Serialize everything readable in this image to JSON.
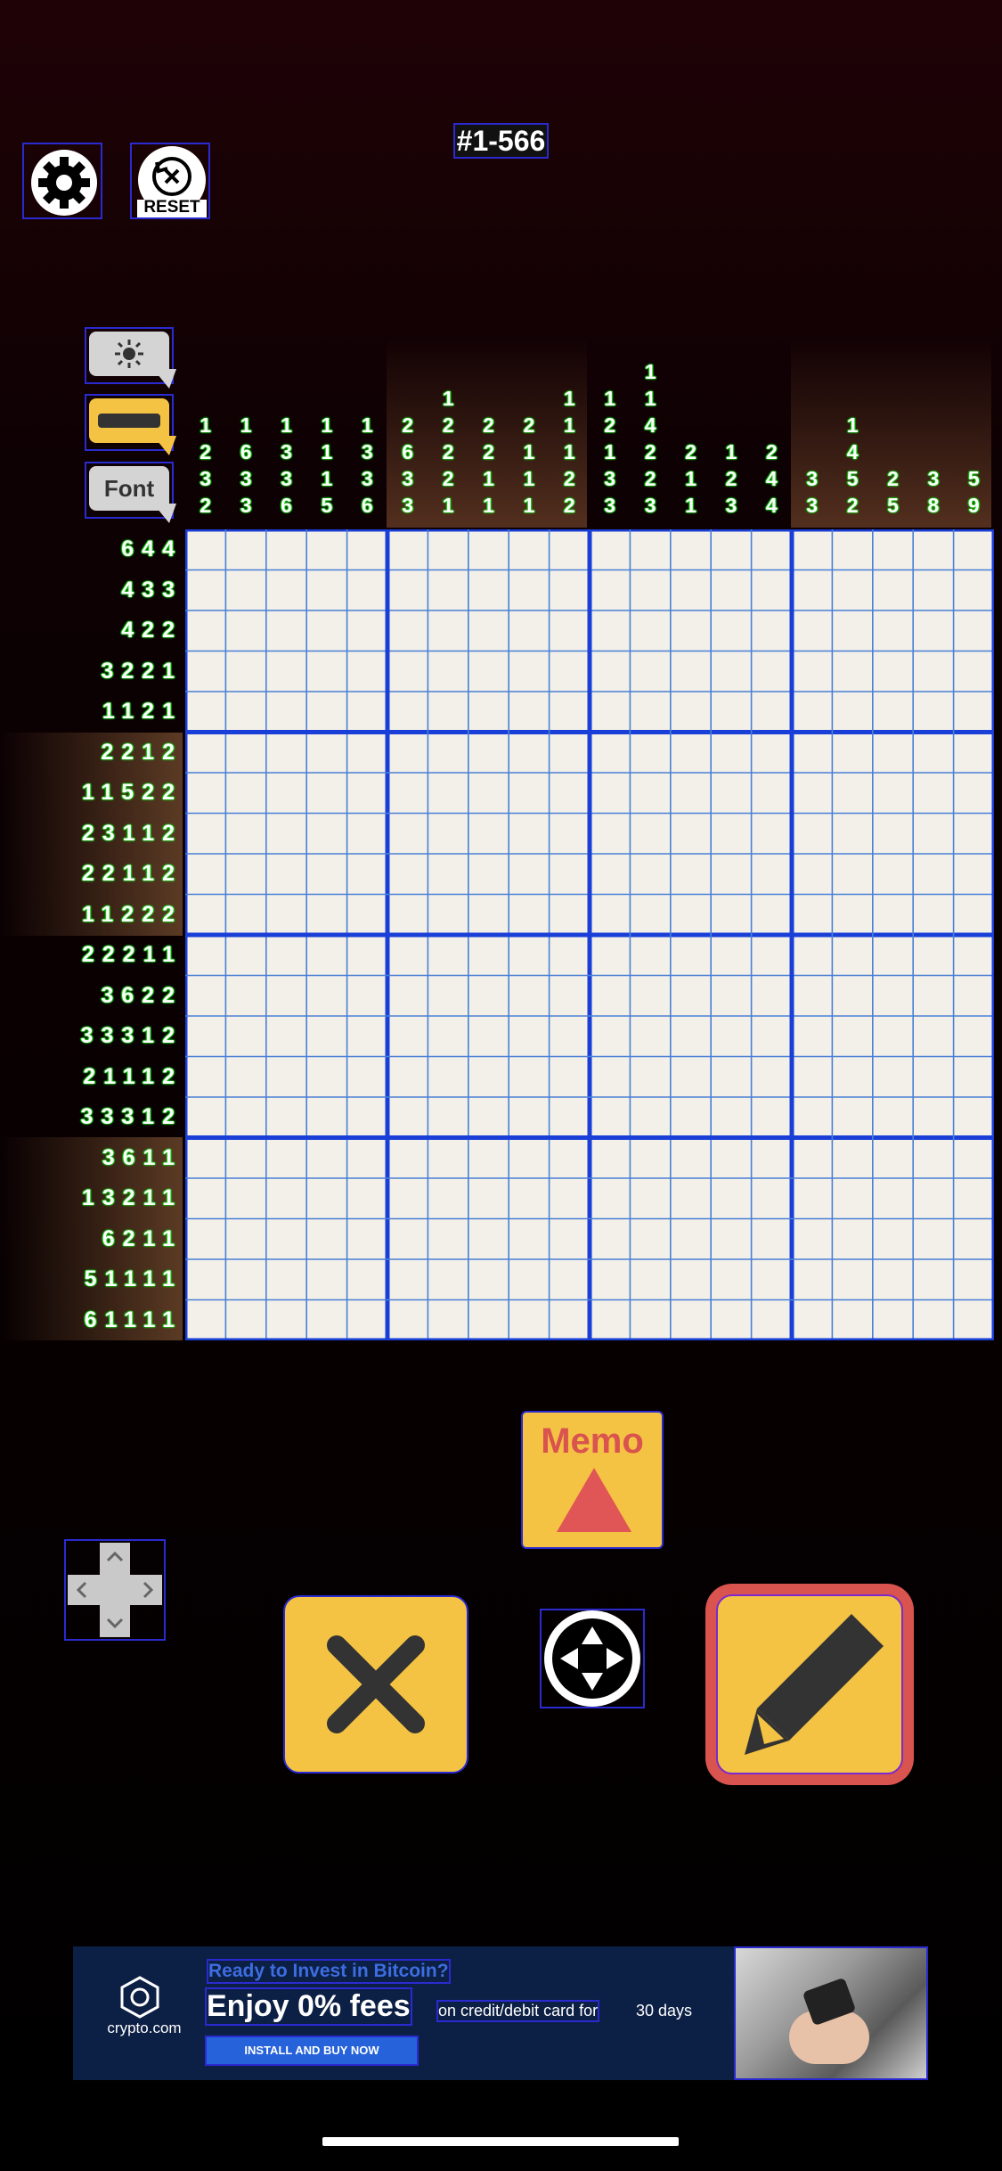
{
  "header": {
    "puzzle_id": "#1-566",
    "reset_label": "RESET"
  },
  "tools": {
    "font_label": "Font"
  },
  "column_clues": [
    [
      "1",
      "2",
      "3",
      "2"
    ],
    [
      "1",
      "6",
      "3",
      "3"
    ],
    [
      "1",
      "3",
      "3",
      "6"
    ],
    [
      "1",
      "1",
      "1",
      "5"
    ],
    [
      "1",
      "3",
      "3",
      "6"
    ],
    [
      "2",
      "6",
      "3",
      "3"
    ],
    [
      "1",
      "2",
      "2",
      "2",
      "1"
    ],
    [
      "2",
      "2",
      "1",
      "1"
    ],
    [
      "2",
      "1",
      "1",
      "1"
    ],
    [
      "1",
      "1",
      "1",
      "2",
      "2"
    ],
    [
      "1",
      "2",
      "1",
      "3",
      "3"
    ],
    [
      "1",
      "1",
      "4",
      "2",
      "2",
      "3"
    ],
    [
      "2",
      "1",
      "1"
    ],
    [
      "1",
      "2",
      "3"
    ],
    [
      "2",
      "4",
      "4"
    ],
    [
      "3",
      "3"
    ],
    [
      "1",
      "4",
      "5",
      "2"
    ],
    [
      "2",
      "5"
    ],
    [
      "3",
      "8"
    ],
    [
      "5",
      "9"
    ]
  ],
  "row_clues": [
    "6 4 4",
    "4 3 3",
    "4 2 2",
    "3 2 2 1",
    "1 1 2 1",
    "2 2 1 2",
    "1 1 5 2 2",
    "2 3 1 1 2",
    "2 2 1 1 2",
    "1 1 2 2 2",
    "2 2 2 1 1",
    "3 6 2 2",
    "3 3 3 1 2",
    "2 1 1 1 2",
    "3 3 3 1 2",
    "3 6 1 1",
    "1 3 2 1 1",
    "6 2 1 1",
    "5 1 1 1 1",
    "6 1 1 1 1"
  ],
  "grid": {
    "size": 20,
    "block": 5,
    "filled_cells": 0
  },
  "controls": {
    "memo_label": "Memo",
    "icons": {
      "settings": "gear-icon",
      "reset": "reset-icon",
      "brightness": "sun-icon",
      "dpad": "dpad-icon",
      "cross": "cross-icon",
      "move": "move-arrows-icon",
      "pencil": "pencil-icon"
    }
  },
  "ad": {
    "brand": "crypto.com",
    "headline": "Ready to Invest in Bitcoin?",
    "offer": "Enjoy 0% fees",
    "offer_detail": "on credit/debit card for",
    "offer_days": "30 days",
    "cta": "INSTALL AND BUY NOW"
  },
  "colors": {
    "accent_yellow": "#f4c343",
    "accent_red": "#d9534f",
    "clue_green": "#14d414",
    "grid_line": "#4a7fd6",
    "grid_bold": "#1a3fd8",
    "cell_bg": "#f2f0e8"
  }
}
